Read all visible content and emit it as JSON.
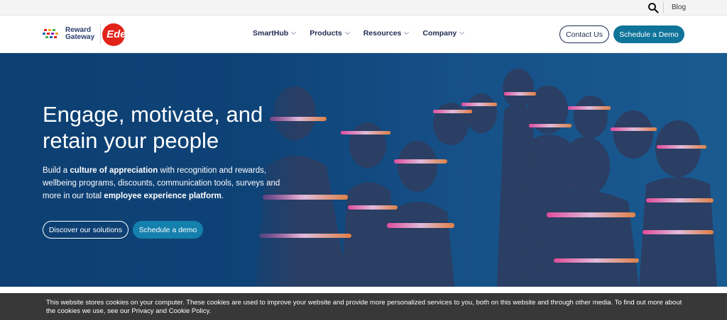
{
  "utility": {
    "blog_label": "Blog",
    "search_icon": "search-icon"
  },
  "brand": {
    "logo_line1": "Reward",
    "logo_line2": "Gateway",
    "partner_logo": "Edenred",
    "colors": {
      "navy": "#1d2b4f",
      "teal": "#10749a",
      "red": "#e2231a"
    }
  },
  "nav": {
    "items": [
      {
        "label": "SmartHub"
      },
      {
        "label": "Products"
      },
      {
        "label": "Resources"
      },
      {
        "label": "Company"
      }
    ],
    "contact_label": "Contact Us",
    "demo_label": "Schedule a Demo"
  },
  "hero": {
    "title": "Engage, motivate, and retain your people",
    "sub_1": "Build a ",
    "sub_bold_1": "culture of appreciation",
    "sub_2": " with recognition and rewards, wellbeing programs, discounts, communication tools, surveys and more in our total ",
    "sub_bold_2": "employee experience platform",
    "sub_3": ".",
    "discover_label": "Discover our solutions",
    "demo_label": "Schedule a demo"
  },
  "cookie": {
    "text": "This website stores cookies on your computer. These cookies are used to improve your website and provide more personalized services to you, both on this website and through other media. To find out more about the cookies we use, see our ",
    "privacy_label": "Privacy",
    "and_text": " and ",
    "policy_label": "Cookie Policy",
    "end_text": "."
  }
}
